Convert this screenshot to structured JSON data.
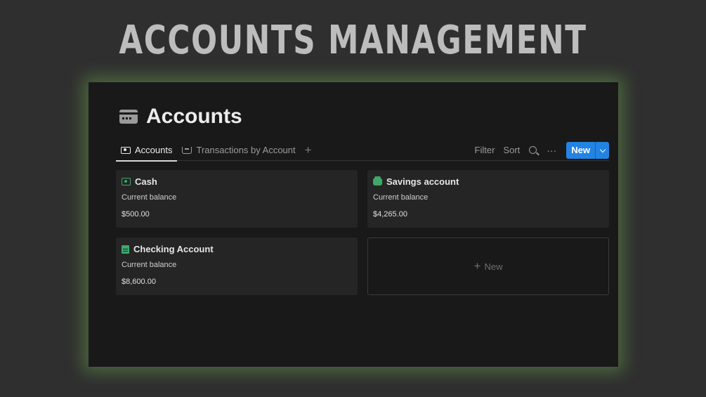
{
  "hero": {
    "title": "ACCOUNTS MANAGEMENT"
  },
  "page": {
    "icon": "card-icon",
    "title": "Accounts"
  },
  "tabs": [
    {
      "label": "Accounts",
      "icon": "money-icon",
      "active": true
    },
    {
      "label": "Transactions by Account",
      "icon": "tray-icon",
      "active": false
    }
  ],
  "toolbar": {
    "filter_label": "Filter",
    "sort_label": "Sort",
    "more_label": "···",
    "new_label": "New"
  },
  "cards": [
    {
      "name": "Cash",
      "icon": "cash-icon",
      "label": "Current balance",
      "value": "$500.00"
    },
    {
      "name": "Savings account",
      "icon": "bank-icon",
      "label": "Current balance",
      "value": "$4,265.00"
    },
    {
      "name": "Checking Account",
      "icon": "ledger-icon",
      "label": "Current balance",
      "value": "$8,600.00"
    }
  ],
  "new_card": {
    "label": "New"
  },
  "colors": {
    "accent": "#2383e2",
    "icon_green": "#3ea86a",
    "glow": "#6eaa50",
    "window_bg": "#191919",
    "page_bg": "#2f2f2f"
  }
}
